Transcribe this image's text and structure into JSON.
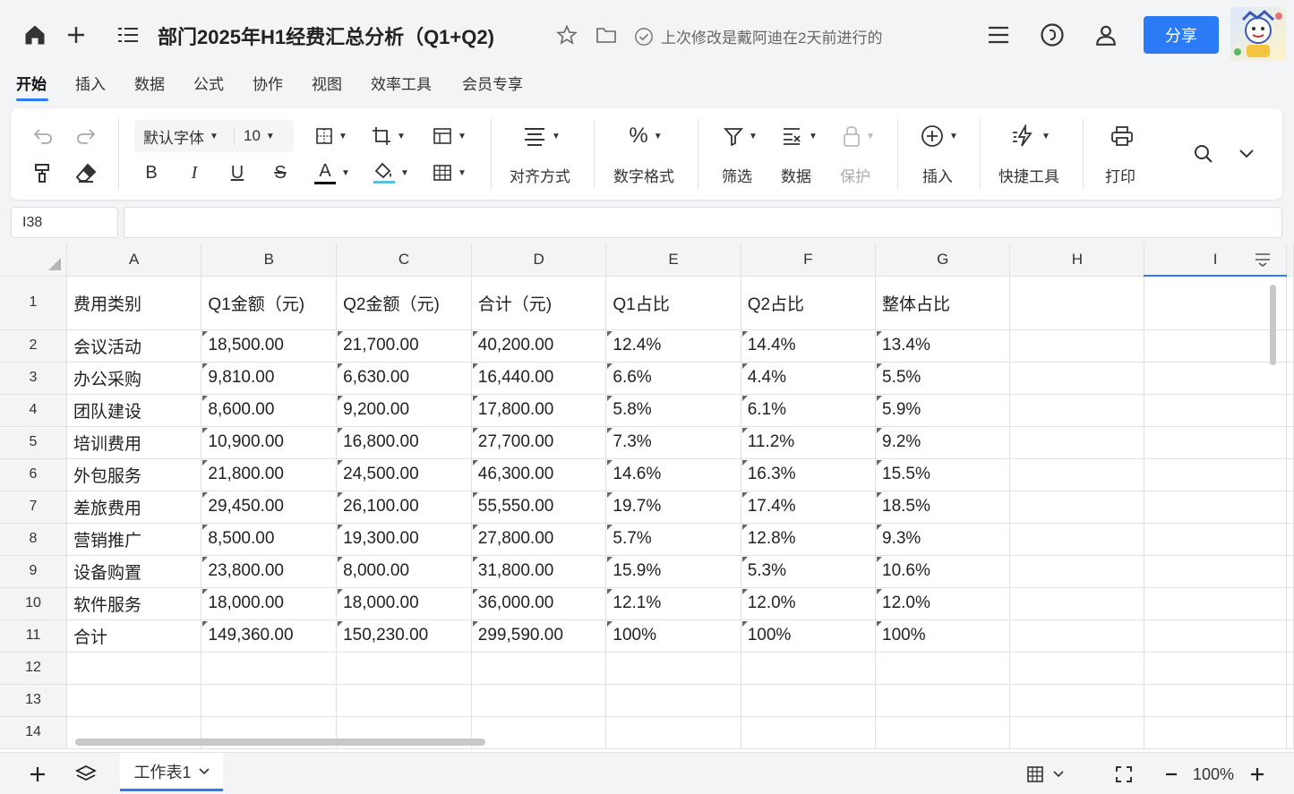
{
  "header": {
    "title": "部门2025年H1经费汇总分析（Q1+Q2)",
    "status": "上次修改是戴阿迪在2天前进行的",
    "share_label": "分享"
  },
  "menu": {
    "items": [
      {
        "label": "开始"
      },
      {
        "label": "插入"
      },
      {
        "label": "数据"
      },
      {
        "label": "公式"
      },
      {
        "label": "协作"
      },
      {
        "label": "视图"
      },
      {
        "label": "效率工具"
      },
      {
        "label": "会员专享"
      }
    ]
  },
  "toolbar": {
    "font_name": "默认字体",
    "font_size": "10",
    "align_label": "对齐方式",
    "number_format_label": "数字格式",
    "filter_label": "筛选",
    "data_label": "数据",
    "protect_label": "保护",
    "insert_label": "插入",
    "quick_tools_label": "快捷工具",
    "print_label": "打印",
    "bold": "B",
    "italic": "I",
    "underline": "U",
    "strike": "S",
    "font_color": "A",
    "percent": "%",
    "font_color_accent": "#111111",
    "fill_color_accent": "#5bc0de"
  },
  "formula_bar": {
    "cell_ref": "I38",
    "content": ""
  },
  "sheet": {
    "columns": [
      "A",
      "B",
      "C",
      "D",
      "E",
      "F",
      "G",
      "H",
      "I"
    ],
    "selected_column": "I",
    "row_numbers": [
      "1",
      "2",
      "3",
      "4",
      "5",
      "6",
      "7",
      "8",
      "9",
      "10",
      "11",
      "12",
      "13",
      "14"
    ],
    "rows": [
      [
        "费用类别",
        "Q1金额（元)",
        "Q2金额（元)",
        "合计（元)",
        "Q1占比",
        "Q2占比",
        "整体占比",
        "",
        ""
      ],
      [
        "会议活动",
        "18,500.00",
        "21,700.00",
        "40,200.00",
        "12.4%",
        "14.4%",
        "13.4%",
        "",
        ""
      ],
      [
        "办公采购",
        "9,810.00",
        "6,630.00",
        "16,440.00",
        "6.6%",
        "4.4%",
        "5.5%",
        "",
        ""
      ],
      [
        "团队建设",
        "8,600.00",
        "9,200.00",
        "17,800.00",
        "5.8%",
        "6.1%",
        "5.9%",
        "",
        ""
      ],
      [
        "培训费用",
        "10,900.00",
        "16,800.00",
        "27,700.00",
        "7.3%",
        "11.2%",
        "9.2%",
        "",
        ""
      ],
      [
        "外包服务",
        "21,800.00",
        "24,500.00",
        "46,300.00",
        "14.6%",
        "16.3%",
        "15.5%",
        "",
        ""
      ],
      [
        "差旅费用",
        "29,450.00",
        "26,100.00",
        "55,550.00",
        "19.7%",
        "17.4%",
        "18.5%",
        "",
        ""
      ],
      [
        "营销推广",
        "8,500.00",
        "19,300.00",
        "27,800.00",
        "5.7%",
        "12.8%",
        "9.3%",
        "",
        ""
      ],
      [
        "设备购置",
        "23,800.00",
        "8,000.00",
        "31,800.00",
        "15.9%",
        "5.3%",
        "10.6%",
        "",
        ""
      ],
      [
        "软件服务",
        "18,000.00",
        "18,000.00",
        "36,000.00",
        "12.1%",
        "12.0%",
        "12.0%",
        "",
        ""
      ],
      [
        "合计",
        "149,360.00",
        "150,230.00",
        "299,590.00",
        "100%",
        "100%",
        "100%",
        "",
        ""
      ],
      [
        "",
        "",
        "",
        "",
        "",
        "",
        "",
        "",
        ""
      ],
      [
        "",
        "",
        "",
        "",
        "",
        "",
        "",
        "",
        ""
      ],
      [
        "",
        "",
        "",
        "",
        "",
        "",
        "",
        "",
        ""
      ]
    ]
  },
  "bottom": {
    "sheet_tab": "工作表1",
    "zoom": "100%"
  },
  "colors": {
    "accent": "#2a7bf5",
    "background": "#f3f4f6"
  }
}
